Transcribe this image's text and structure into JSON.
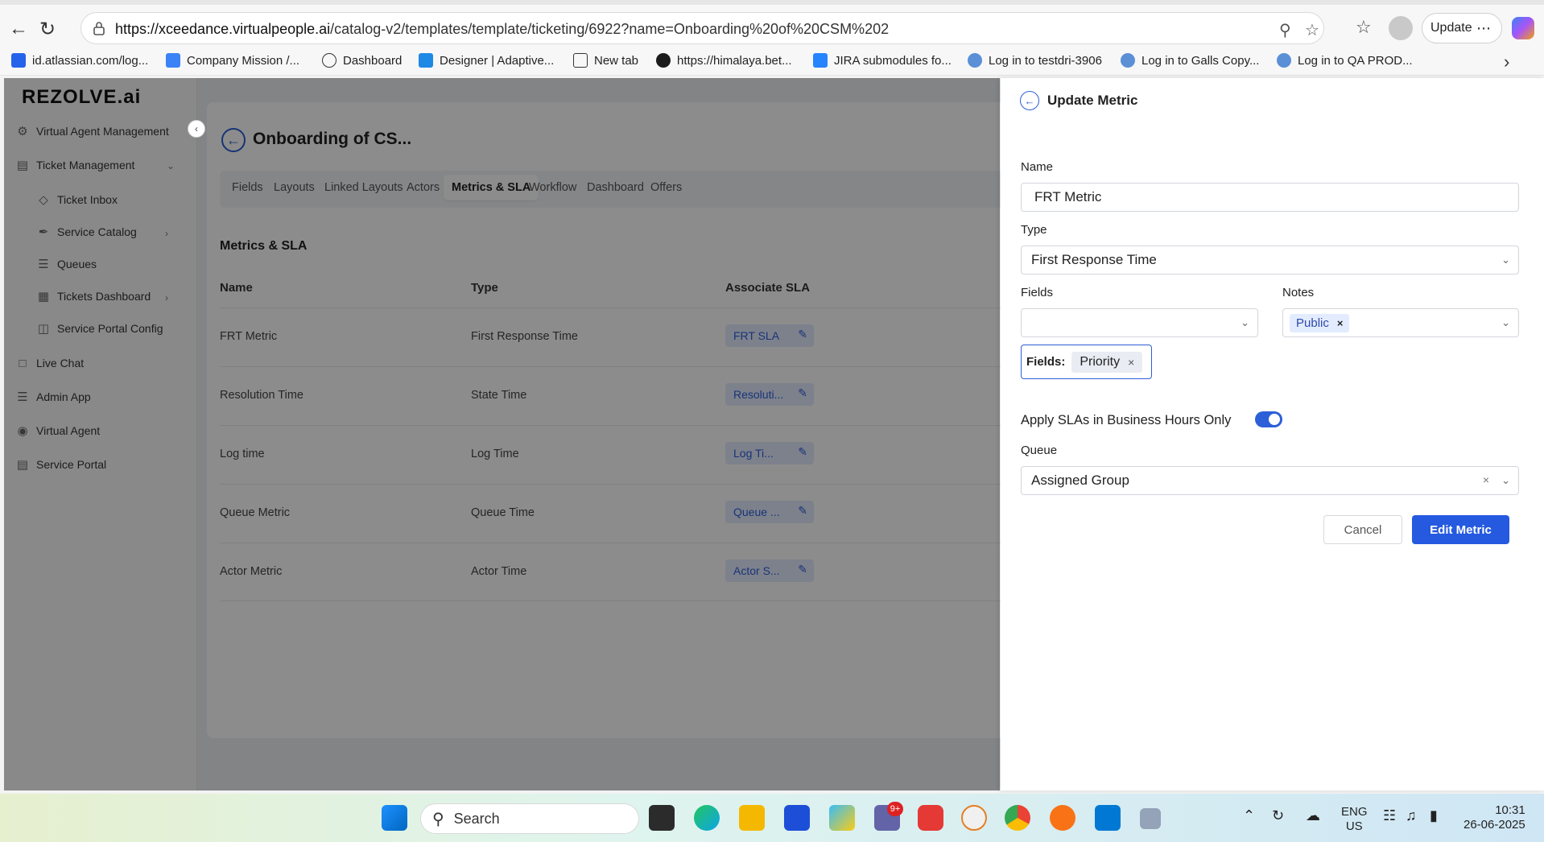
{
  "browser": {
    "url_host": "https://xceedance.virtualpeople.ai",
    "url_path": "/catalog-v2/templates/template/ticketing/6922?name=Onboarding%20of%20CSM%202",
    "update_label": "Update",
    "bookmarks": [
      "id.atlassian.com/log...",
      "Company Mission /...",
      "Dashboard",
      "Designer | Adaptive...",
      "New tab",
      "https://himalaya.bet...",
      "JIRA submodules fo...",
      "Log in to testdri-3906",
      "Log in to Galls Copy...",
      "Log in to QA PROD..."
    ]
  },
  "sidebar": {
    "logo": "REZOLVE.ai",
    "items": [
      {
        "label": "Virtual Agent Management"
      },
      {
        "label": "Ticket Management"
      },
      {
        "label": "Ticket Inbox"
      },
      {
        "label": "Service Catalog"
      },
      {
        "label": "Queues"
      },
      {
        "label": "Tickets Dashboard"
      },
      {
        "label": "Service Portal Config"
      },
      {
        "label": "Live Chat"
      },
      {
        "label": "Admin App"
      },
      {
        "label": "Virtual Agent"
      },
      {
        "label": "Service Portal"
      }
    ]
  },
  "main": {
    "page_title": "Onboarding of CS...",
    "tabs": [
      "Fields",
      "Layouts",
      "Linked Layouts",
      "Actors",
      "Metrics & SLA",
      "Workflow",
      "Dashboard",
      "Offers"
    ],
    "active_tab": "Metrics & SLA",
    "section_title": "Metrics & SLA",
    "columns": [
      "Name",
      "Type",
      "Associate SLA"
    ],
    "rows": [
      {
        "name": "FRT Metric",
        "type": "First Response Time",
        "sla": "FRT SLA"
      },
      {
        "name": "Resolution Time",
        "type": "State Time",
        "sla": "Resoluti..."
      },
      {
        "name": "Log time",
        "type": "Log Time",
        "sla": "Log Ti..."
      },
      {
        "name": "Queue Metric",
        "type": "Queue Time",
        "sla": "Queue ..."
      },
      {
        "name": "Actor Metric",
        "type": "Actor Time",
        "sla": "Actor S..."
      }
    ]
  },
  "drawer": {
    "title": "Update Metric",
    "name_label": "Name",
    "name_value": "FRT Metric",
    "type_label": "Type",
    "type_value": "First Response Time",
    "fields_label": "Fields",
    "notes_label": "Notes",
    "notes_chip": "Public",
    "fields_box_label": "Fields:",
    "fields_chip": "Priority",
    "business_hours_label": "Apply SLAs in Business Hours Only",
    "business_hours_on": true,
    "queue_label": "Queue",
    "queue_value": "Assigned Group",
    "cancel_label": "Cancel",
    "submit_label": "Edit Metric",
    "accent_color": "#2459e0"
  },
  "taskbar": {
    "search_label": "Search",
    "lang_line1": "ENG",
    "lang_line2": "US",
    "time": "10:31",
    "date": "26-06-2025",
    "teams_badge": "9+"
  }
}
